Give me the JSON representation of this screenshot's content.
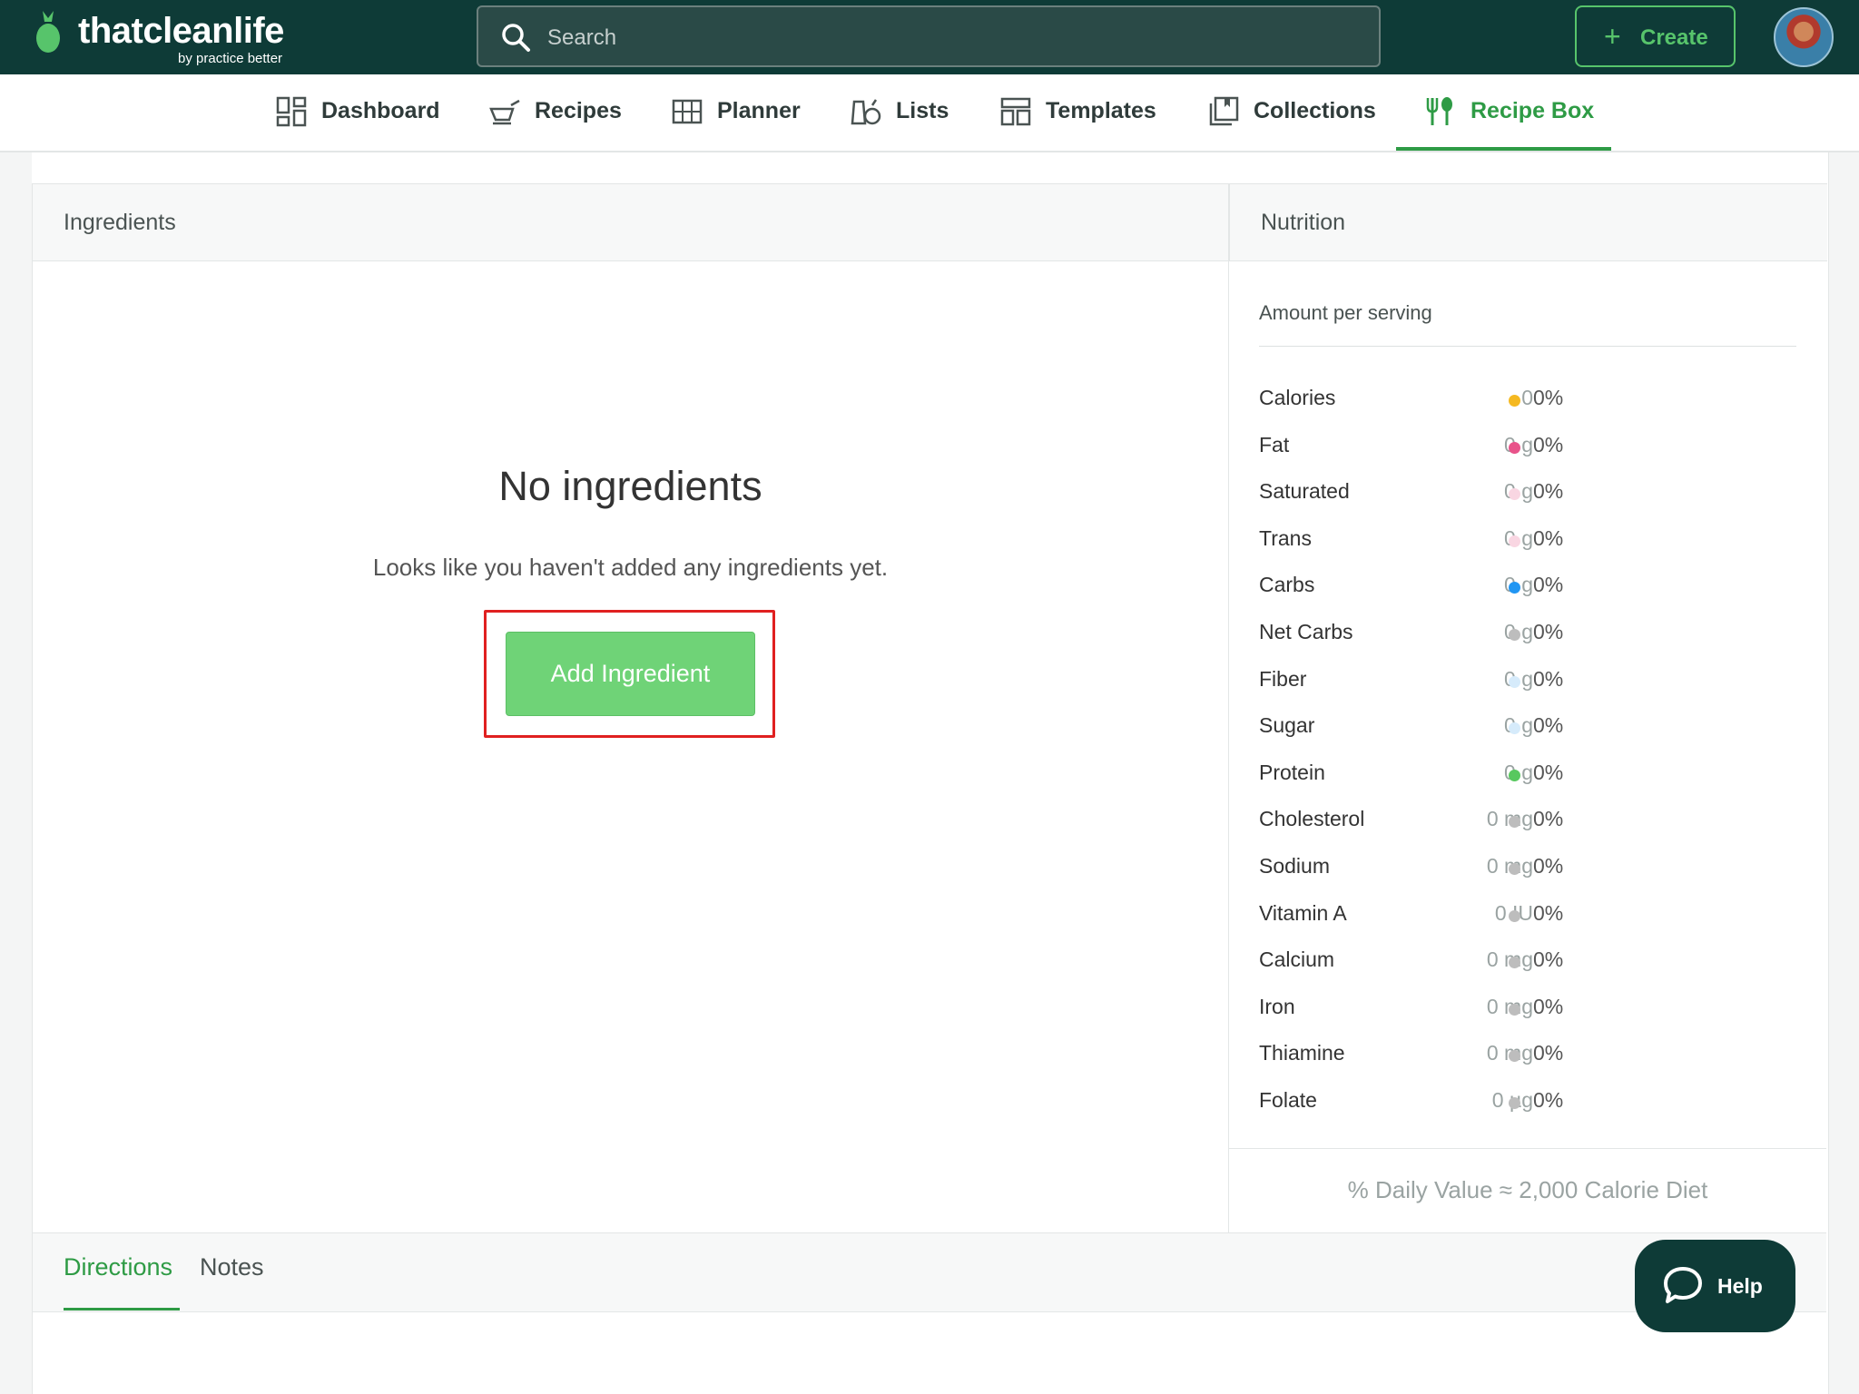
{
  "brand": {
    "name": "thatcleanlife",
    "byline": "by practice better"
  },
  "search": {
    "placeholder": "Search"
  },
  "header": {
    "create_label": "Create"
  },
  "nav": {
    "items": [
      {
        "label": "Dashboard",
        "icon": "dashboard-icon"
      },
      {
        "label": "Recipes",
        "icon": "recipes-icon"
      },
      {
        "label": "Planner",
        "icon": "planner-icon"
      },
      {
        "label": "Lists",
        "icon": "lists-icon"
      },
      {
        "label": "Templates",
        "icon": "templates-icon"
      },
      {
        "label": "Collections",
        "icon": "collections-icon"
      },
      {
        "label": "Recipe Box",
        "icon": "fork-spoon-icon"
      }
    ],
    "active": "Recipe Box"
  },
  "ingredients": {
    "heading": "Ingredients",
    "empty_title": "No ingredients",
    "empty_subtitle": "Looks like you haven't added any ingredients yet.",
    "add_button": "Add Ingredient"
  },
  "nutrition": {
    "heading": "Nutrition",
    "amount_label": "Amount per serving",
    "rows": [
      {
        "name": "Calories",
        "value": "0",
        "pct": "0%",
        "color": "#f5b921"
      },
      {
        "name": "Fat",
        "value": "0 g",
        "pct": "0%",
        "color": "#e8538a"
      },
      {
        "name": "Saturated",
        "value": "0 g",
        "pct": "0%",
        "color": "#f9d6e2"
      },
      {
        "name": "Trans",
        "value": "0 g",
        "pct": "0%",
        "color": "#f9d6e2"
      },
      {
        "name": "Carbs",
        "value": "0 g",
        "pct": "0%",
        "color": "#2196f3"
      },
      {
        "name": "Net Carbs",
        "value": "0 g",
        "pct": "0%",
        "color": "#bdbdbd"
      },
      {
        "name": "Fiber",
        "value": "0 g",
        "pct": "0%",
        "color": "#d6ebfb"
      },
      {
        "name": "Sugar",
        "value": "0 g",
        "pct": "0%",
        "color": "#d6ebfb"
      },
      {
        "name": "Protein",
        "value": "0 g",
        "pct": "0%",
        "color": "#58c85f"
      },
      {
        "name": "Cholesterol",
        "value": "0 mg",
        "pct": "0%",
        "color": "#bdbdbd"
      },
      {
        "name": "Sodium",
        "value": "0 mg",
        "pct": "0%",
        "color": "#bdbdbd"
      },
      {
        "name": "Vitamin A",
        "value": "0 IU",
        "pct": "0%",
        "color": "#bdbdbd"
      },
      {
        "name": "Calcium",
        "value": "0 mg",
        "pct": "0%",
        "color": "#bdbdbd"
      },
      {
        "name": "Iron",
        "value": "0 mg",
        "pct": "0%",
        "color": "#bdbdbd"
      },
      {
        "name": "Thiamine",
        "value": "0 mg",
        "pct": "0%",
        "color": "#bdbdbd"
      },
      {
        "name": "Folate",
        "value": "0 µg",
        "pct": "0%",
        "color": "#bdbdbd"
      }
    ],
    "footer": "% Daily Value ≈ 2,000 Calorie Diet"
  },
  "tabs": {
    "directions": "Directions",
    "notes": "Notes",
    "active": "Directions"
  },
  "help": {
    "label": "Help"
  }
}
